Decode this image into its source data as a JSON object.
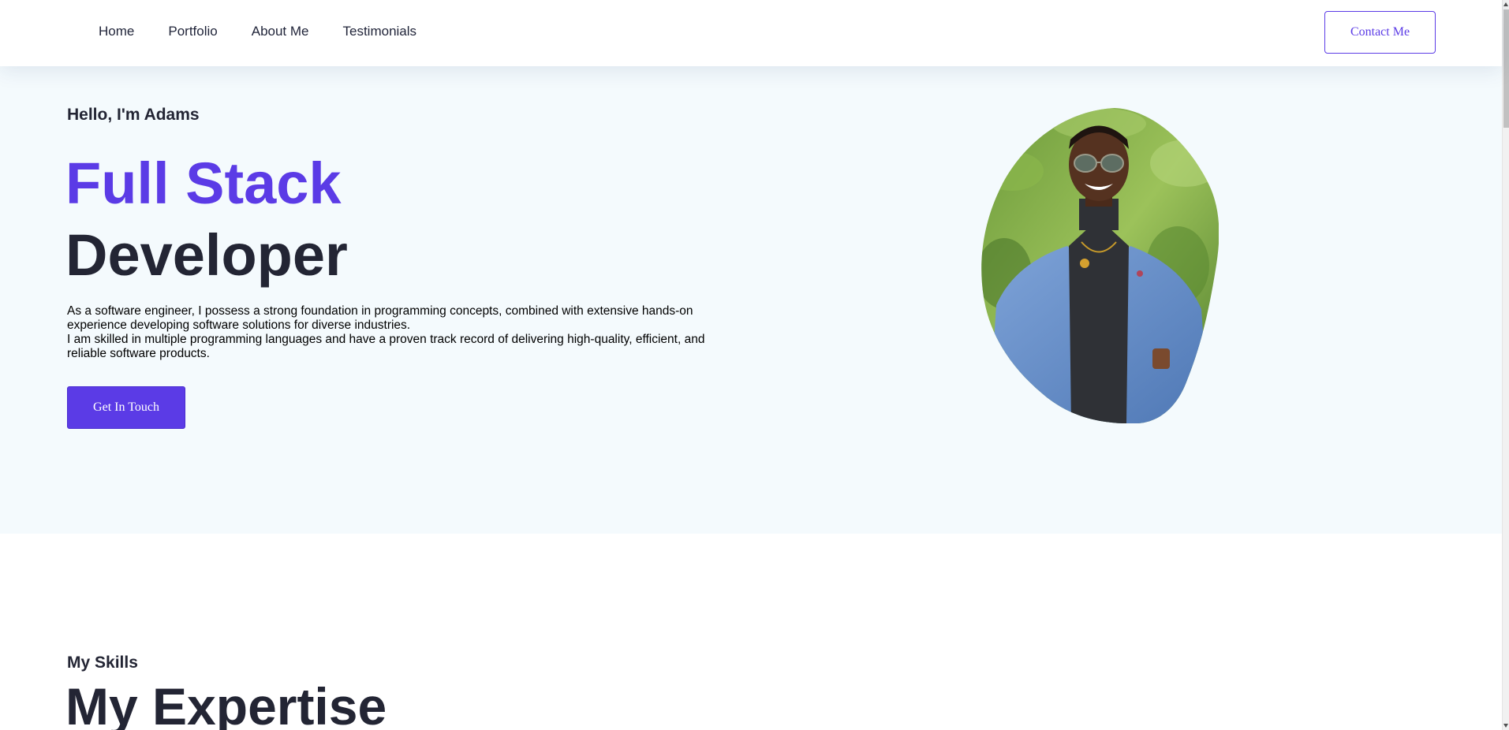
{
  "nav": {
    "links": [
      "Home",
      "Portfolio",
      "About Me",
      "Testimonials"
    ],
    "contact_label": "Contact Me"
  },
  "hero": {
    "greeting": "Hello, I'm Adams",
    "title_line1": "Full Stack",
    "title_line2": "Developer",
    "description": [
      "As a software engineer, I possess a strong foundation in programming concepts, combined with extensive hands-on",
      "experience developing software solutions for diverse industries.",
      "I am skilled in multiple programming languages and have a proven track record of delivering high-quality, efficient, and",
      "reliable software products."
    ],
    "cta_label": "Get In Touch",
    "portrait_icon": "profile-photo"
  },
  "skills": {
    "subtitle": "My Skills",
    "title": "My Expertise"
  },
  "colors": {
    "accent": "#5b3be6",
    "heading": "#232534",
    "hero_bg": "#f4fafd"
  }
}
